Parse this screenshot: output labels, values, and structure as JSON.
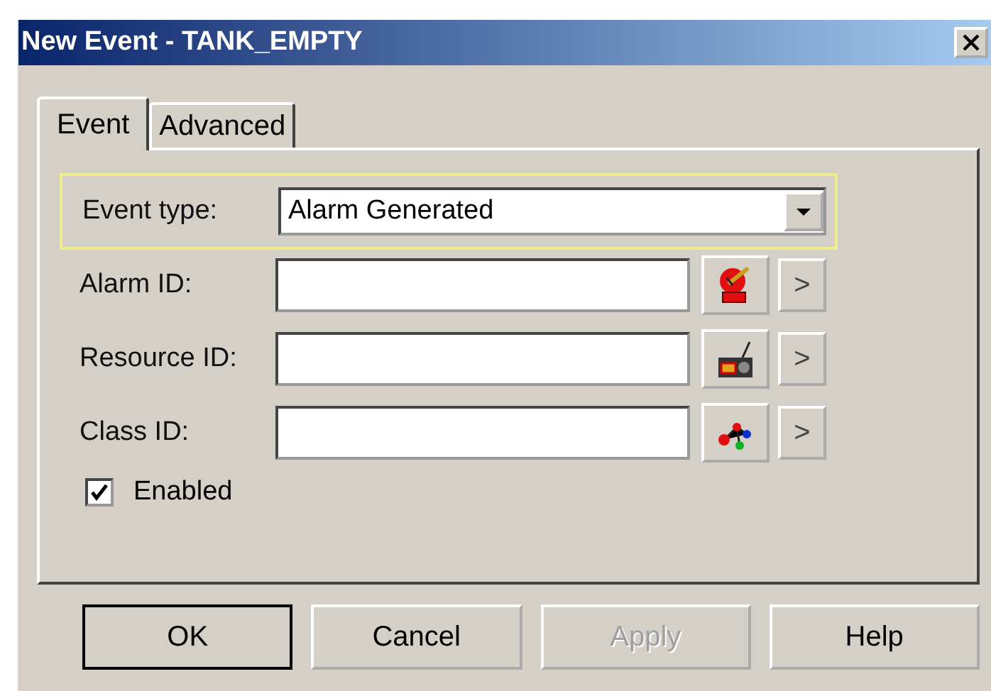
{
  "window": {
    "title": "New Event - TANK_EMPTY"
  },
  "tabs": [
    {
      "label": "Event",
      "selected": true
    },
    {
      "label": "Advanced",
      "selected": false
    }
  ],
  "event_type": {
    "label": "Event type:",
    "value": "Alarm Generated",
    "focused": true
  },
  "fields": [
    {
      "label": "Alarm ID:",
      "browse": ">"
    },
    {
      "label": "Resource ID:",
      "browse": ">"
    },
    {
      "label": "Class ID:",
      "browse": ">"
    }
  ],
  "enabled": {
    "label": "Enabled",
    "checked": true
  },
  "buttons": [
    {
      "label": "OK",
      "default": true,
      "disabled": false
    },
    {
      "label": "Cancel",
      "default": false,
      "disabled": false
    },
    {
      "label": "Apply",
      "default": false,
      "disabled": true
    },
    {
      "label": "Help",
      "default": false,
      "disabled": false
    }
  ]
}
